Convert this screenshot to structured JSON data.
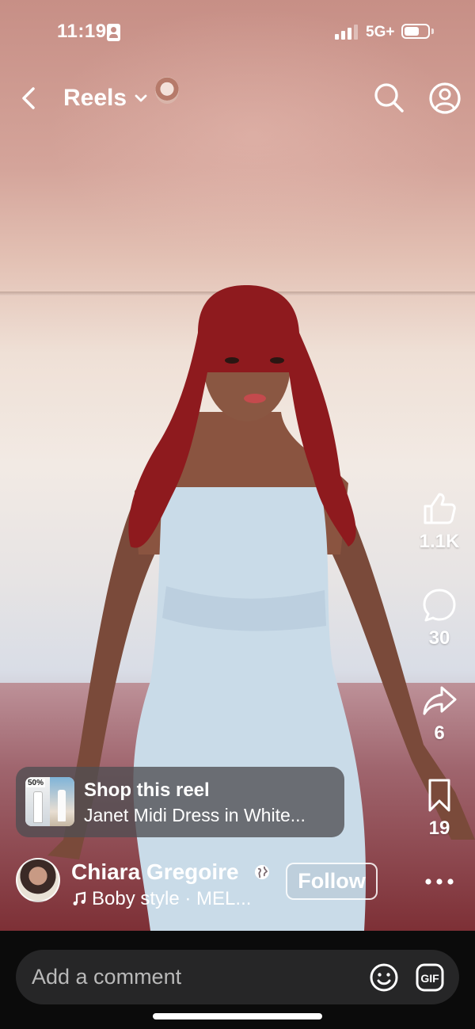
{
  "status_bar": {
    "time": "11:19",
    "network": "5G+",
    "id_icon": "contact-card-icon",
    "signal_icon": "cellular-signal-icon",
    "battery_icon": "battery-icon"
  },
  "header": {
    "title": "Reels",
    "back_icon": "chevron-left-icon",
    "dropdown_icon": "chevron-down-icon",
    "search_icon": "search-icon",
    "profile_icon": "profile-icon"
  },
  "actions": {
    "like": {
      "icon": "thumbs-up-icon",
      "count": "1.1K"
    },
    "comment": {
      "icon": "comment-icon",
      "count": "30"
    },
    "share": {
      "icon": "share-icon",
      "count": "6"
    },
    "save": {
      "icon": "bookmark-icon",
      "count": "19"
    }
  },
  "shop": {
    "title": "Shop this reel",
    "product": "Janet Midi Dress in White...",
    "thumbnail_badge": "50%"
  },
  "author": {
    "name": "Chiara Gregoire",
    "audio": "Boby style · MEL...",
    "follow_label": "Follow",
    "globe_icon": "globe-icon",
    "music_icon": "music-note-icon",
    "more_icon": "more-horizontal-icon"
  },
  "comment_bar": {
    "placeholder": "Add a comment",
    "emoji_icon": "smiley-icon",
    "gif_icon": "gif-icon"
  },
  "colors": {
    "text": "#ffffff",
    "bottom_bar": "#0b0b0b",
    "comment_box": "#262627",
    "shop_card": "#504e52"
  }
}
